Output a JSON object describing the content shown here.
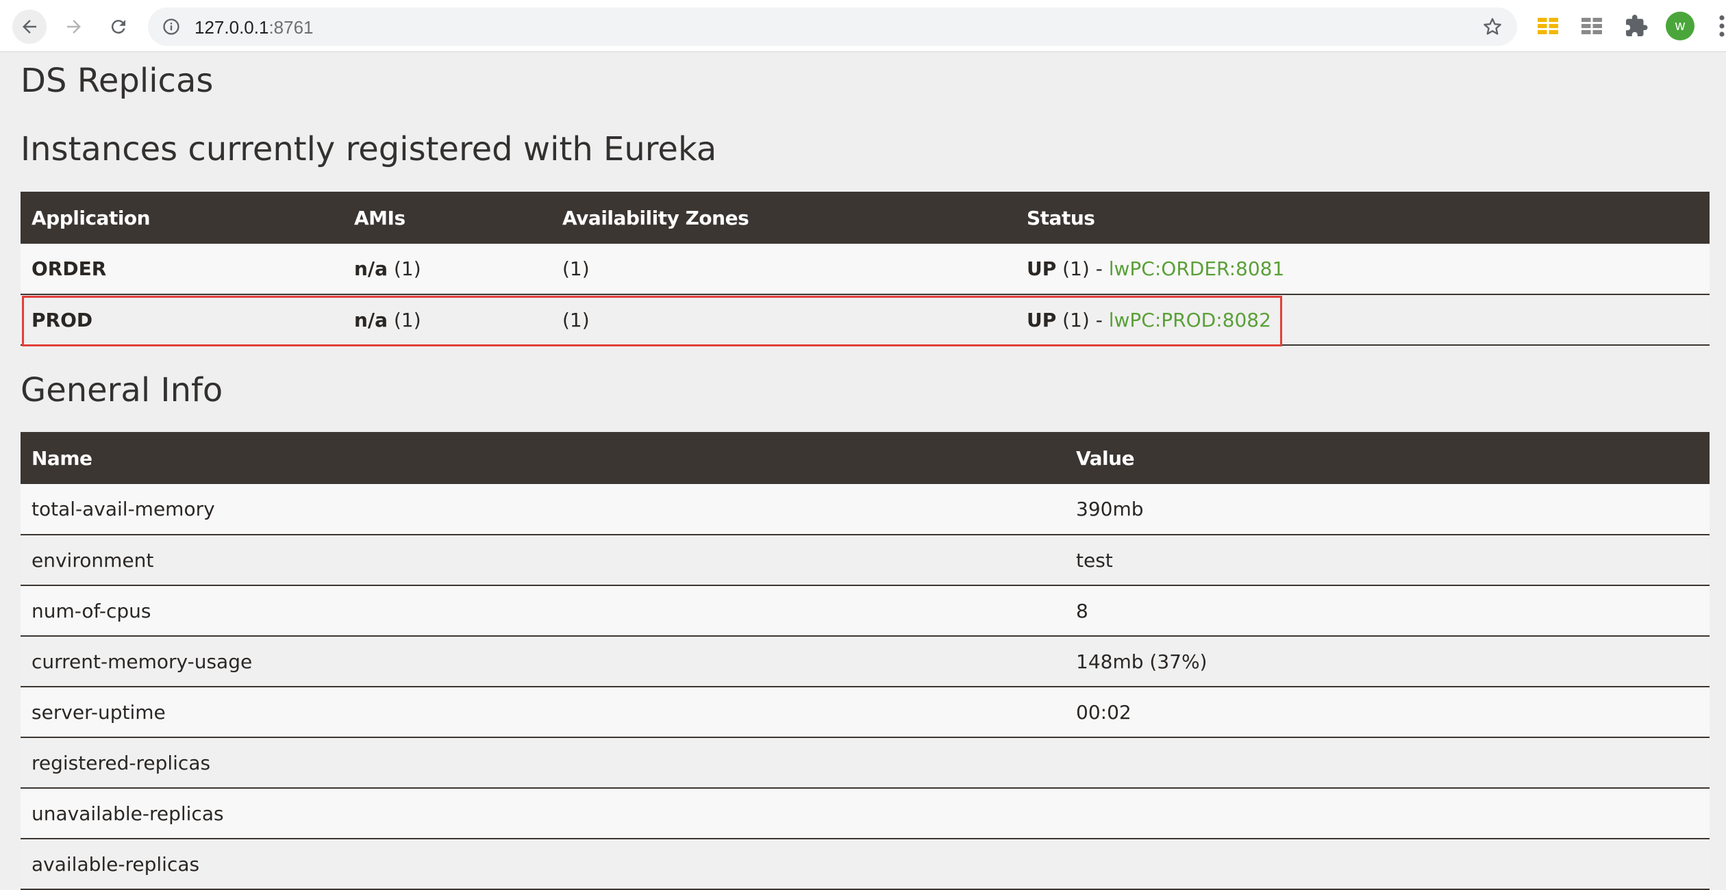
{
  "browser": {
    "url_host": "127.0.0.1",
    "url_port": ":8761",
    "avatar_letter": "w"
  },
  "headings": {
    "replicas": "DS Replicas",
    "instances": "Instances currently registered with Eureka",
    "general": "General Info"
  },
  "instances_table": {
    "columns": [
      "Application",
      "AMIs",
      "Availability Zones",
      "Status"
    ],
    "rows": [
      {
        "application": "ORDER",
        "amis_bold": "n/a",
        "amis_count": " (1)",
        "zones": "(1)",
        "status_bold": "UP",
        "status_count": " (1) - ",
        "status_link": "lwPC:ORDER:8081"
      },
      {
        "application": "PROD",
        "amis_bold": "n/a",
        "amis_count": " (1)",
        "zones": "(1)",
        "status_bold": "UP",
        "status_count": " (1) - ",
        "status_link": "lwPC:PROD:8082"
      }
    ]
  },
  "general_table": {
    "columns": [
      "Name",
      "Value"
    ],
    "rows": [
      {
        "name": "total-avail-memory",
        "value": "390mb"
      },
      {
        "name": "environment",
        "value": "test"
      },
      {
        "name": "num-of-cpus",
        "value": "8"
      },
      {
        "name": "current-memory-usage",
        "value": "148mb (37%)"
      },
      {
        "name": "server-uptime",
        "value": "00:02"
      },
      {
        "name": "registered-replicas",
        "value": ""
      },
      {
        "name": "unavailable-replicas",
        "value": ""
      },
      {
        "name": "available-replicas",
        "value": ""
      }
    ]
  },
  "colors": {
    "header_bg": "#3b3632",
    "link": "#5aa038",
    "highlight": "#e0403a"
  }
}
